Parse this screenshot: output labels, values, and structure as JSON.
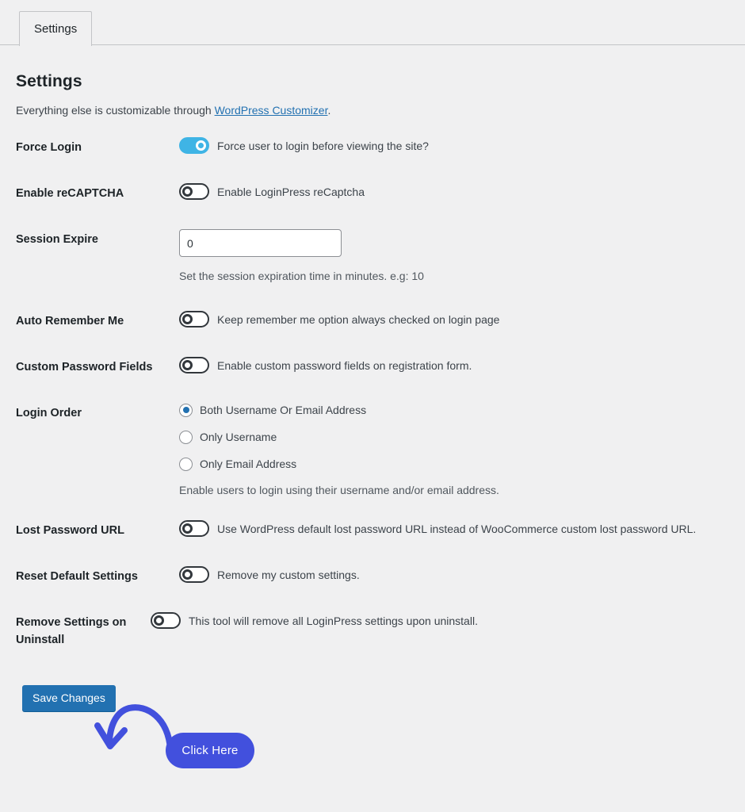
{
  "tabs": [
    {
      "label": "Settings",
      "active": true
    }
  ],
  "header": {
    "title": "Settings",
    "subtitle_before": "Everything else is customizable through ",
    "subtitle_link": "WordPress Customizer",
    "subtitle_after": "."
  },
  "rows": [
    {
      "label": "Force Login",
      "control": "toggle",
      "state": "on",
      "text": "Force user to login before viewing the site?"
    },
    {
      "label": "Enable reCAPTCHA",
      "control": "toggle",
      "state": "off",
      "text": "Enable LoginPress reCaptcha"
    },
    {
      "label": "Session Expire",
      "control": "input",
      "value": "0",
      "placeholder": "0",
      "help": "Set the session expiration time in minutes. e.g: 10"
    },
    {
      "label": "Auto Remember Me",
      "control": "toggle",
      "state": "off",
      "text": "Keep remember me option always checked on login page"
    },
    {
      "label": "Custom Password Fields",
      "control": "toggle",
      "state": "off",
      "text": "Enable custom password fields on registration form."
    },
    {
      "label": "Login Order",
      "control": "radio",
      "options": [
        {
          "label": "Both Username Or Email Address",
          "checked": true
        },
        {
          "label": "Only Username",
          "checked": false
        },
        {
          "label": "Only Email Address",
          "checked": false
        }
      ],
      "help": "Enable users to login using their username and/or email address."
    },
    {
      "label": "Lost Password URL",
      "control": "toggle",
      "state": "off",
      "text": "Use WordPress default lost password URL instead of WooCommerce custom lost password URL."
    },
    {
      "label": "Reset Default Settings",
      "control": "toggle",
      "state": "off",
      "text": "Remove my custom settings."
    },
    {
      "label": "Remove Settings on Uninstall",
      "control": "toggle",
      "state": "off",
      "text": "This tool will remove all LoginPress settings upon uninstall."
    }
  ],
  "footer": {
    "save_label": "Save Changes"
  },
  "annotation": {
    "pill_label": "Click Here",
    "pill_color": "#4250dd",
    "arrow_color": "#4250dd"
  },
  "colors": {
    "background": "#f0f0f1",
    "toggle_on": "#3fb4e5",
    "toggle_off_border": "#32373c",
    "link": "#2271b1",
    "save_button": "#2271b1",
    "label_text": "#1d2327",
    "body_text": "#3c434a"
  }
}
